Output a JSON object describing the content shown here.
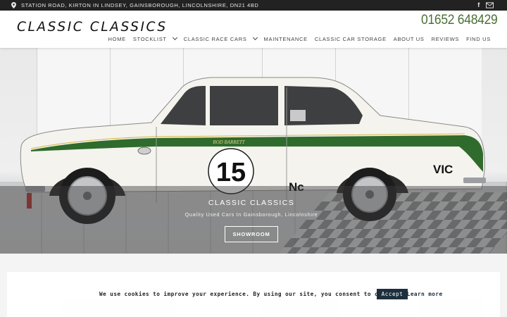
{
  "topbar": {
    "address": "STATION ROAD, KIRTON IN LINDSEY, GAINSBOROUGH, LINCOLNSHIRE, DN21 4BD",
    "icons": [
      "map-pin-icon",
      "facebook-icon",
      "mail-icon"
    ]
  },
  "header": {
    "logo": "CLASSIC CLASSICS",
    "phone": "01652 648429",
    "phone_color": "#4b6f37"
  },
  "nav": {
    "items": [
      {
        "label": "HOME",
        "has_dropdown": false
      },
      {
        "label": "STOCKLIST",
        "has_dropdown": true
      },
      {
        "label": "CLASSIC RACE CARS",
        "has_dropdown": true
      },
      {
        "label": "MAINTENANCE",
        "has_dropdown": false
      },
      {
        "label": "CLASSIC CAR STORAGE",
        "has_dropdown": false
      },
      {
        "label": "ABOUT US",
        "has_dropdown": false
      },
      {
        "label": "REVIEWS",
        "has_dropdown": false
      },
      {
        "label": "FIND US",
        "has_dropdown": false
      }
    ]
  },
  "hero": {
    "title": "CLASSIC CLASSICS",
    "subtitle": "Quality Used Cars In Gainsborough, Lincolnshire",
    "button": "SHOWROOM",
    "car": {
      "race_number": "15",
      "driver_name": "ROD BARRETT",
      "rear_text": "VIC",
      "class_text": "Nc",
      "stripe_color": "#2f6b2c",
      "body_color": "#f4f3ee"
    }
  },
  "cookie": {
    "message": "We use cookies to improve your experience. By using our site, you consent to cookies.",
    "learn_more": "Learn more",
    "accept": "Accept"
  }
}
